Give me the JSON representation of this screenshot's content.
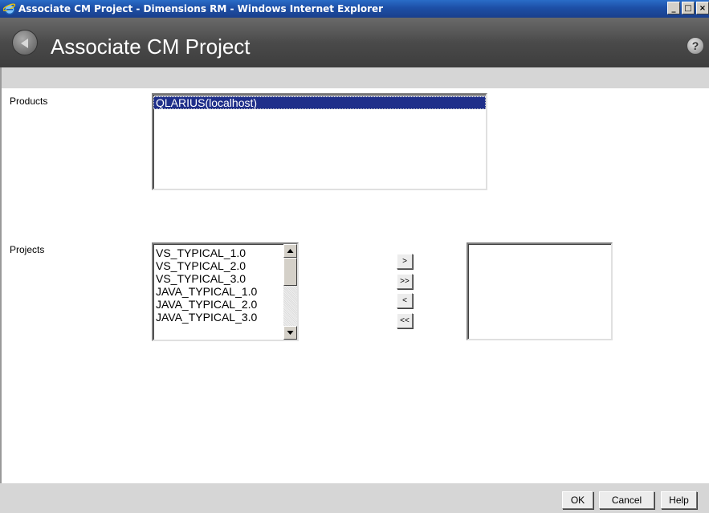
{
  "window": {
    "title": "Associate CM Project - Dimensions RM - Windows Internet Explorer",
    "icon": "ie-icon",
    "controls": {
      "minimize": "_",
      "maximize": "□",
      "close": "×"
    }
  },
  "header": {
    "title": "Associate CM Project",
    "back_icon": "back-arrow-icon",
    "help_icon": "?"
  },
  "form": {
    "products_label": "Products",
    "products": [
      "QLARIUS(localhost)"
    ],
    "selected_product": "QLARIUS(localhost)",
    "projects_label": "Projects",
    "projects": [
      "VS_TYPICAL_1.0",
      "VS_TYPICAL_2.0",
      "VS_TYPICAL_3.0",
      "JAVA_TYPICAL_1.0",
      "JAVA_TYPICAL_2.0",
      "JAVA_TYPICAL_3.0"
    ],
    "move_buttons": {
      "add": ">",
      "add_all": ">>",
      "remove": "<",
      "remove_all": "<<"
    },
    "selected_projects": []
  },
  "footer": {
    "ok": "OK",
    "cancel": "Cancel",
    "help": "Help"
  },
  "colors": {
    "selection": "#1f2f8a",
    "header_bg": "#4a4a4a",
    "strip_bg": "#d6d6d6",
    "titlebar_bg": "#1d4fa6"
  }
}
